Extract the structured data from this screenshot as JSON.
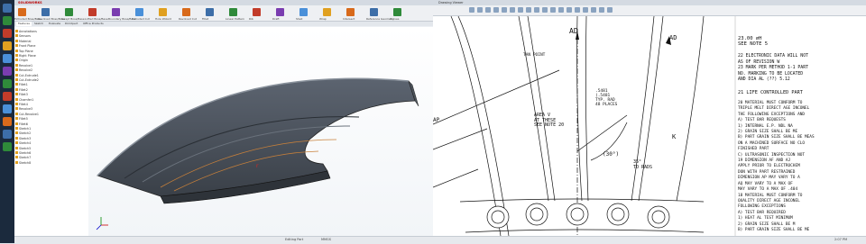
{
  "left_window": {
    "title": "SOLIDWORKS",
    "toolbar_labels": [
      "Extruded Boss/Base",
      "Revolved Boss/Base",
      "Swept Boss/Base",
      "Lofted Boss/Base",
      "Boundary Boss/Base",
      "Extruded Cut",
      "Hole Wizard",
      "Revolved Cut",
      "Fillet",
      "Linear Pattern",
      "Rib",
      "Draft",
      "Shell",
      "Wrap",
      "Intersect",
      "Reference Geometry",
      "Curves"
    ],
    "command_tabs": [
      "Features",
      "Sketch",
      "Evaluate",
      "DimXpert",
      "Office Products"
    ],
    "tree_items": [
      "Annotations",
      "Sensors",
      "Material",
      "Front Plane",
      "Top Plane",
      "Right Plane",
      "Origin",
      "Revolve1",
      "Revolve2",
      "Cut-Extrude1",
      "Cut-Extrude2",
      "Fillet1",
      "Fillet2",
      "Fillet3",
      "Chamfer1",
      "Fillet4",
      "Revolve3",
      "Cut-Revolve1",
      "Fillet5",
      "Fillet6",
      "Sketch1",
      "Sketch2",
      "Sketch3",
      "Sketch4",
      "Sketch5",
      "Sketch6",
      "Sketch7",
      "Sketch8"
    ],
    "status": [
      "Editing Part",
      "MMGS"
    ]
  },
  "right_window": {
    "title": "Drawing Viewer",
    "drawing_notes": {
      "n_top": [
        "23.00 ⌀H",
        "SEE NOTE 5"
      ],
      "n22": [
        "22  ELECTRONIC DATA WILL NOT",
        "    AS OF REVISION W",
        "23  MARK PER METHOD 1-1 PART",
        "    NO. MARKING TO BE LOCATED",
        "    AND DIA AL (??) 5.12"
      ],
      "n21": "21  LIFE CONTROLLED PART",
      "n20": [
        "20  MATERIAL MUST CONFORM TO",
        "    TRIPLE MELT DIRECT AGE INCONEL",
        "    THE FOLLOWING EXCEPTIONS AND",
        "    A) TEST BAR REQUESTS",
        "       1) INTERNAL E.P. NDL NA",
        "       2) GRAIN SIZE SHALL BE ME",
        "    B) PART GRAIN SIZE SHALL BE MEAS",
        "       ON A MACHINED SURFACE NO CLO",
        "       FINISHED PART",
        "    C) ULTRASONIC INSPECTION NOT",
        "19  DIMENSION AF AND AJ",
        "    APPLY PRIOR TO ELECTROCHEM",
        "    DON WITH PART RESTRAINED",
        "    DIMENSION AP MAY VARY TO A",
        "    AQ MAY VARY TO A MAX OF",
        "    MAY VARY TO A MAX OF .404",
        "18  MATERIAL MUST CONFORM TO",
        "    QUALITY DIRECT AGE INCONEL",
        "    FOLLOWING EXCEPTIONS",
        "    A) TEST BAR REQUIRED",
        "       1) HEAT AL TEST MINIMUM",
        "       2) GRAIN SIZE SHALL BE M",
        "    B) PART GRAIN SIZE SHALL BE ME"
      ],
      "labels": {
        "ad_left": "AD",
        "ad_right": "AD",
        "tan_point": "TAN POINT",
        "area_v": [
          "AREA V",
          "AT THESE",
          "SEE NOTE 20"
        ],
        "rad": [
          ".5481",
          "(.5481",
          "TYP. RAD",
          "48 PLACES"
        ],
        "angle": "(30°)",
        "angle2": [
          "35°",
          "TO RADS"
        ],
        "k": "K",
        "ap": "AP"
      }
    },
    "status": "2:07 PM"
  }
}
